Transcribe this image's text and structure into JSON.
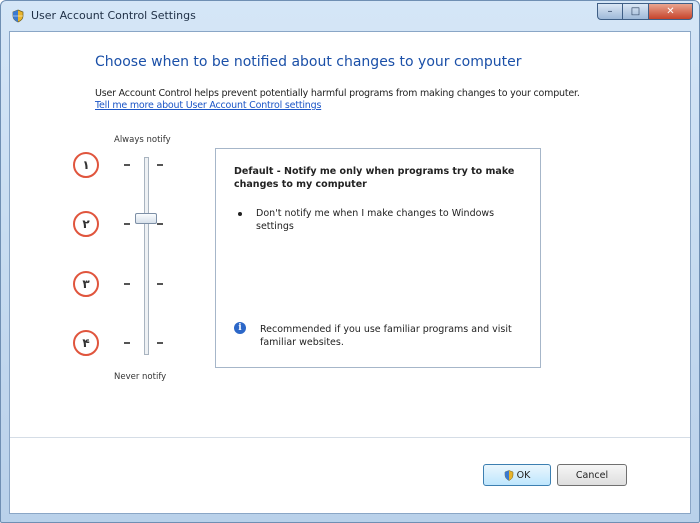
{
  "window": {
    "title": "User Account Control Settings",
    "icon": "uac-shield-icon",
    "caption_min": "–",
    "caption_max": "□",
    "caption_close": "✕"
  },
  "main": {
    "heading": "Choose when to be notified about changes to your computer",
    "description": "User Account Control helps prevent potentially harmful programs from making changes to your computer.",
    "learn_more_link": "Tell me more about User Account Control settings"
  },
  "slider": {
    "top_label": "Always notify",
    "bottom_label": "Never notify",
    "levels": [
      "۱",
      "۲",
      "۳",
      "۴"
    ],
    "selected_level": 2
  },
  "info": {
    "title": "Default - Notify me only when programs try to make changes to my computer",
    "bullet": "Don't notify me when I make changes to Windows settings",
    "recommendation": "Recommended if you use familiar programs and visit familiar websites.",
    "info_icon": "info-icon"
  },
  "buttons": {
    "ok": "OK",
    "cancel": "Cancel"
  },
  "colors": {
    "heading": "#1b50a8",
    "link": "#1b55c6",
    "level_circle": "#e0553d"
  }
}
